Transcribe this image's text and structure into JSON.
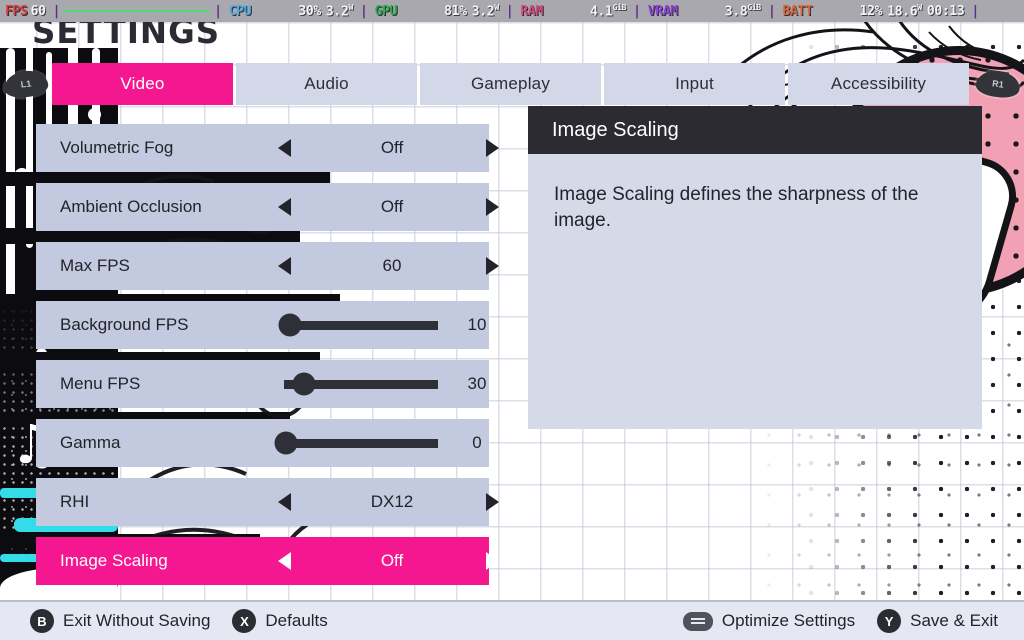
{
  "stats_overlay": {
    "items": [
      {
        "label": "FPS",
        "value": "60",
        "kind": "fps"
      },
      {
        "label": "CPU",
        "value": "30%",
        "value2": "3.2",
        "unit2": "W",
        "kind": "cpu"
      },
      {
        "label": "GPU",
        "value": "81%",
        "value2": "3.2",
        "unit2": "W",
        "kind": "gpu"
      },
      {
        "label": "RAM",
        "value": "4.1",
        "unit": "GiB",
        "kind": "ram"
      },
      {
        "label": "VRAM",
        "value": "3.8",
        "unit": "GiB",
        "kind": "vram"
      },
      {
        "label": "BATT",
        "value": "12%",
        "value2": "18.6",
        "unit2": "W",
        "time": "00:13",
        "kind": "batt"
      }
    ],
    "fps_label": "FPS",
    "fps_value": "60",
    "cpu_label": "CPU",
    "cpu_pct": "30%",
    "cpu_watt": "3.2",
    "cpu_watt_unit": "W",
    "gpu_label": "GPU",
    "gpu_pct": "81%",
    "gpu_watt": "3.2",
    "gpu_watt_unit": "W",
    "ram_label": "RAM",
    "ram_value": "4.1",
    "ram_unit": "GiB",
    "vram_label": "VRAM",
    "vram_value": "3.8",
    "vram_unit": "GiB",
    "batt_label": "BATT",
    "batt_pct": "12%",
    "batt_watt": "18.6",
    "batt_watt_unit": "W",
    "batt_time": "00:13",
    "separator": "|"
  },
  "header": {
    "title": "SETTINGS"
  },
  "tabbar": {
    "left_bumper": "L1",
    "right_bumper": "R1",
    "tabs": [
      {
        "label": "Video",
        "active": true
      },
      {
        "label": "Audio",
        "active": false
      },
      {
        "label": "Gameplay",
        "active": false
      },
      {
        "label": "Input",
        "active": false
      },
      {
        "label": "Accessibility",
        "active": false
      }
    ]
  },
  "settings": {
    "rows": [
      {
        "label": "Volumetric Fog",
        "type": "option",
        "value": "Off",
        "selected": false
      },
      {
        "label": "Ambient Occlusion",
        "type": "option",
        "value": "Off",
        "selected": false
      },
      {
        "label": "Max FPS",
        "type": "option",
        "value": "60",
        "selected": false
      },
      {
        "label": "Background FPS",
        "type": "slider",
        "value": "10",
        "percent": 4,
        "selected": false
      },
      {
        "label": "Menu FPS",
        "type": "slider",
        "value": "30",
        "percent": 13,
        "selected": false
      },
      {
        "label": "Gamma",
        "type": "slider",
        "value": "0",
        "percent": 1,
        "selected": false
      },
      {
        "label": "RHI",
        "type": "option",
        "value": "DX12",
        "selected": false
      },
      {
        "label": "Image Scaling",
        "type": "option",
        "value": "Off",
        "selected": true
      }
    ]
  },
  "info_panel": {
    "title": "Image Scaling",
    "description": "Image Scaling defines the sharpness of the image."
  },
  "bottom_bar": {
    "left_actions": [
      {
        "glyph": "B",
        "glyph_kind": "circle",
        "label": "Exit Without Saving"
      },
      {
        "glyph": "X",
        "glyph_kind": "circle",
        "label": "Defaults"
      }
    ],
    "right_actions": [
      {
        "glyph": "",
        "glyph_kind": "pill",
        "label": "Optimize Settings"
      },
      {
        "glyph": "Y",
        "glyph_kind": "circle",
        "label": "Save & Exit"
      }
    ]
  },
  "colors": {
    "accent_pink": "#f5178f",
    "row_bg": "#c3cadf",
    "panel_header": "#2b2b31",
    "panel_body": "#d5dae8",
    "bottom_bar": "#e5e8f2",
    "stats_bar": "#a8a8ae"
  }
}
